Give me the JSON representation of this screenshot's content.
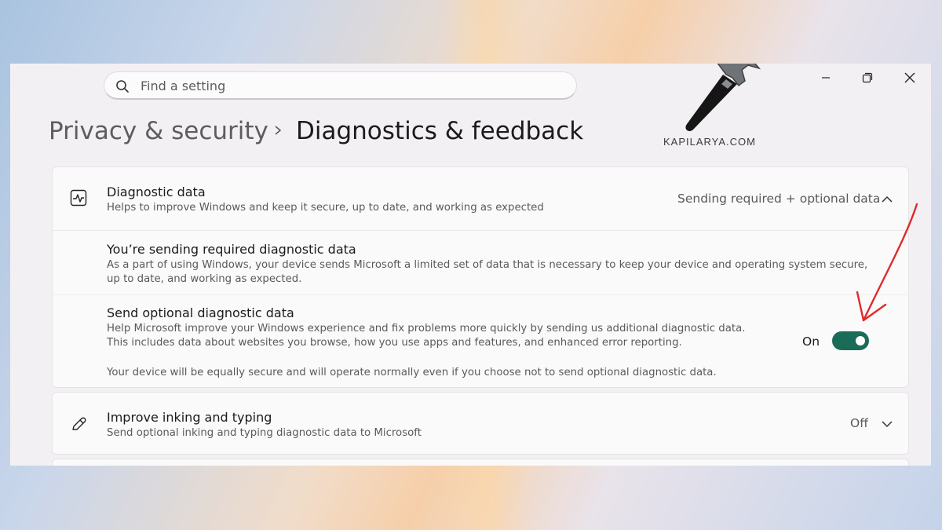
{
  "search": {
    "placeholder": "Find a setting"
  },
  "breadcrumb": {
    "parent": "Privacy & security",
    "current": "Diagnostics & feedback"
  },
  "watermark": {
    "text": "KAPILARYA.COM"
  },
  "diagnostic_data": {
    "title": "Diagnostic data",
    "description": "Helps to improve Windows and keep it secure, up to date, and working as expected",
    "value": "Sending required + optional data",
    "icon": "diagnostic-pulse-icon",
    "expanded": true
  },
  "required_data": {
    "title": "You’re sending required diagnostic data",
    "description": "As a part of using Windows, your device sends Microsoft a limited set of data that is necessary to keep your device and operating system secure, up to date, and working as expected."
  },
  "optional_data": {
    "title": "Send optional diagnostic data",
    "description": "Help Microsoft improve your Windows experience and fix problems more quickly by sending us additional diagnostic data. This includes data about websites you browse, how you use apps and features, and enhanced error reporting.",
    "note": "Your device will be equally secure and will operate normally even if you choose not to send optional diagnostic data.",
    "toggle_label": "On",
    "toggle_state": true,
    "accent_color": "#1a6b57"
  },
  "inking": {
    "title": "Improve inking and typing",
    "description": "Send optional inking and typing diagnostic data to Microsoft",
    "value": "Off",
    "icon": "pen-icon"
  },
  "annotation": {
    "arrow_color": "#e02a2a"
  }
}
